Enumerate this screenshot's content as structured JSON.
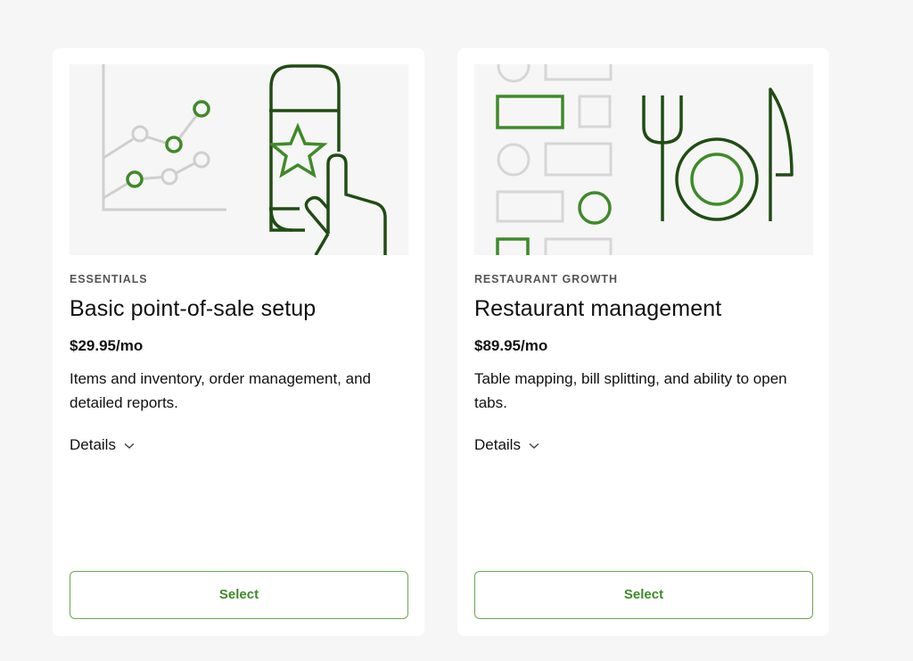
{
  "colors": {
    "background": "#f6f6f6",
    "card": "#ffffff",
    "hero_background": "#f6f6f6",
    "dark_green": "#1f4d12",
    "mid_green": "#3e8a28",
    "light_gray": "#cfcfcf",
    "button_border": "#6fa454"
  },
  "plans": [
    {
      "illustration": "chart-and-phone-star-illustration",
      "category": "ESSENTIALS",
      "title": "Basic point-of-sale setup",
      "price": "$29.95/mo",
      "description": "Items and inventory, order management, and detailed reports.",
      "details_label": "Details",
      "details_icon": "chevron-down-icon",
      "select_label": "Select"
    },
    {
      "illustration": "table-map-and-cutlery-illustration",
      "category": "RESTAURANT GROWTH",
      "title": "Restaurant management",
      "price": "$89.95/mo",
      "description": "Table mapping, bill splitting, and ability to open tabs.",
      "details_label": "Details",
      "details_icon": "chevron-down-icon",
      "select_label": "Select"
    }
  ]
}
